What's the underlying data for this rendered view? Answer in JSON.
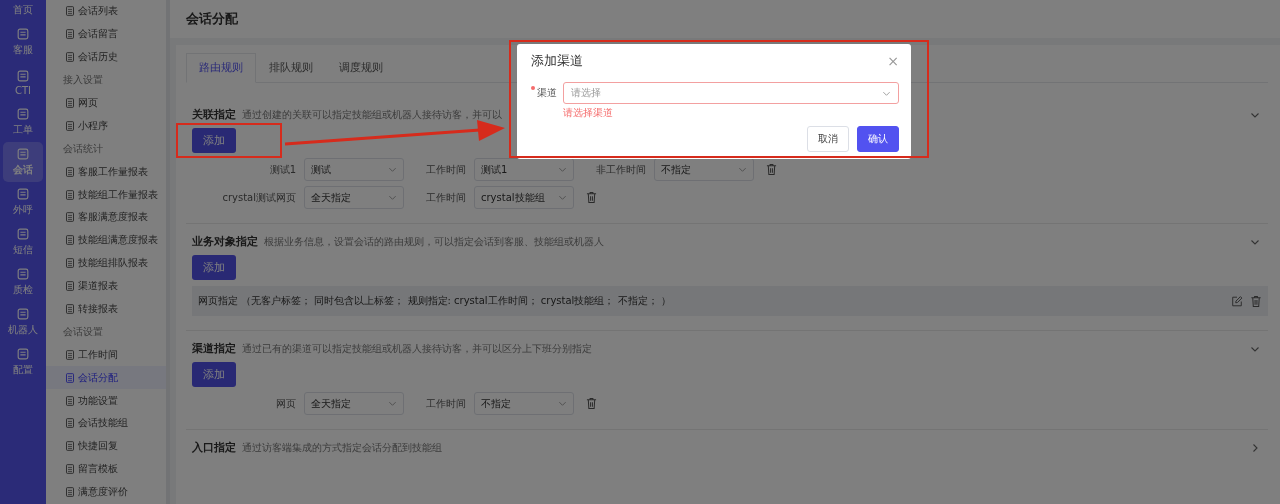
{
  "nav": [
    {
      "label": "首页",
      "selected": false
    },
    {
      "label": "客服",
      "selected": false
    },
    {
      "label": "CTI",
      "selected": false
    },
    {
      "label": "工单",
      "selected": false
    },
    {
      "label": "会话",
      "selected": true
    },
    {
      "label": "外呼",
      "selected": false
    },
    {
      "label": "短信",
      "selected": false
    },
    {
      "label": "质检",
      "selected": false
    },
    {
      "label": "机器人",
      "selected": false
    },
    {
      "label": "配置",
      "selected": false
    }
  ],
  "submenu": [
    {
      "kind": "item",
      "label": "会话列表",
      "selected": false
    },
    {
      "kind": "item",
      "label": "会话留言",
      "selected": false
    },
    {
      "kind": "item",
      "label": "会话历史",
      "selected": false
    },
    {
      "kind": "group",
      "label": "接入设置"
    },
    {
      "kind": "item",
      "label": "网页",
      "selected": false
    },
    {
      "kind": "item",
      "label": "小程序",
      "selected": false
    },
    {
      "kind": "group",
      "label": "会话统计"
    },
    {
      "kind": "item",
      "label": "客服工作量报表",
      "selected": false
    },
    {
      "kind": "item",
      "label": "技能组工作量报表",
      "selected": false
    },
    {
      "kind": "item",
      "label": "客服满意度报表",
      "selected": false
    },
    {
      "kind": "item",
      "label": "技能组满意度报表",
      "selected": false
    },
    {
      "kind": "item",
      "label": "技能组排队报表",
      "selected": false
    },
    {
      "kind": "item",
      "label": "渠道报表",
      "selected": false
    },
    {
      "kind": "item",
      "label": "转接报表",
      "selected": false
    },
    {
      "kind": "group",
      "label": "会话设置"
    },
    {
      "kind": "item",
      "label": "工作时间",
      "selected": false
    },
    {
      "kind": "item",
      "label": "会话分配",
      "selected": true
    },
    {
      "kind": "item",
      "label": "功能设置",
      "selected": false
    },
    {
      "kind": "item",
      "label": "会话技能组",
      "selected": false
    },
    {
      "kind": "item",
      "label": "快捷回复",
      "selected": false
    },
    {
      "kind": "item",
      "label": "留言模板",
      "selected": false
    },
    {
      "kind": "item",
      "label": "满意度评价",
      "selected": false
    }
  ],
  "page_title": "会话分配",
  "tabs": [
    {
      "label": "路由规则",
      "selected": true
    },
    {
      "label": "排队规则",
      "selected": false
    },
    {
      "label": "调度规则",
      "selected": false
    }
  ],
  "sections": [
    {
      "title": "关联指定",
      "description": "通过创建的关联可以指定技能组或机器人接待访客，并可以",
      "expanded": true,
      "add_button": "添加",
      "rules": [
        {
          "fields": [
            {
              "label": "测试1",
              "value": "测试"
            },
            {
              "label": "工作时间",
              "value": "测试1"
            },
            {
              "label": "非工作时间",
              "value": "不指定"
            }
          ]
        },
        {
          "fields": [
            {
              "label": "crystal测试网页",
              "value": "全天指定"
            },
            {
              "label": "工作时间",
              "value": "crystal技能组"
            }
          ]
        }
      ]
    },
    {
      "title": "业务对象指定",
      "description": "根据业务信息，设置会话的路由规则，可以指定会话到客服、技能组或机器人",
      "expanded": true,
      "add_button": "添加",
      "entries": [
        {
          "text": "网页指定 （无客户标签； 同时包含以上标签； 规则指定: crystal工作时间； crystal技能组； 不指定； ）"
        }
      ]
    },
    {
      "title": "渠道指定",
      "description": "通过已有的渠道可以指定技能组或机器人接待访客，并可以区分上下班分别指定",
      "expanded": true,
      "add_button": "添加",
      "rules": [
        {
          "fields": [
            {
              "label": "网页",
              "value": "全天指定"
            },
            {
              "label": "工作时间",
              "value": "不指定"
            }
          ]
        }
      ]
    },
    {
      "title": "入口指定",
      "description": "通过访客端集成的方式指定会话分配到技能组",
      "expanded": false
    }
  ],
  "dialog": {
    "title": "添加渠道",
    "close": "×",
    "field_label": "渠道",
    "required": true,
    "placeholder": "请选择",
    "error": "请选择渠道",
    "buttons": [
      {
        "label": "取消",
        "kind": "default"
      },
      {
        "label": "确认",
        "kind": "primary"
      }
    ]
  }
}
